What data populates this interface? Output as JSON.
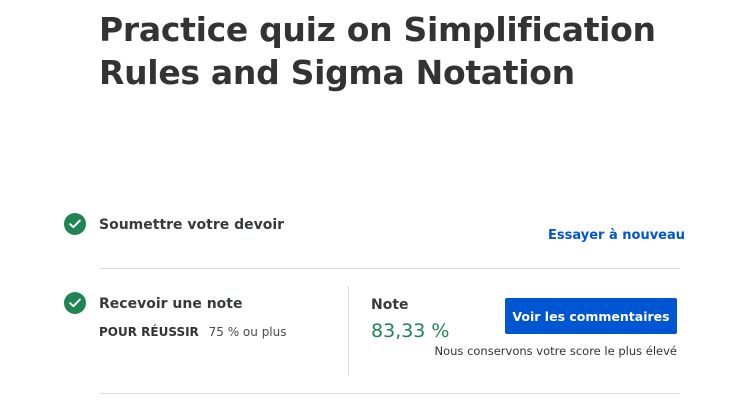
{
  "page": {
    "title": "Practice quiz on Simplification Rules and Sigma Notation"
  },
  "steps": {
    "submit": {
      "title": "Soumettre votre devoir",
      "retry_label": "Essayer à nouveau",
      "status_icon": "check-circle-icon"
    },
    "grade": {
      "title": "Recevoir une note",
      "status_icon": "check-circle-icon",
      "pass_label": "POUR RÉUSSIR",
      "pass_value": "75 % ou plus",
      "grade_label": "Note",
      "grade_value": "83,33 %",
      "feedback_button_label": "Voir les commentaires",
      "keep_note": "Nous conservons votre score le plus élevé"
    }
  },
  "colors": {
    "success": "#1f8354",
    "accent": "#0056d2"
  }
}
